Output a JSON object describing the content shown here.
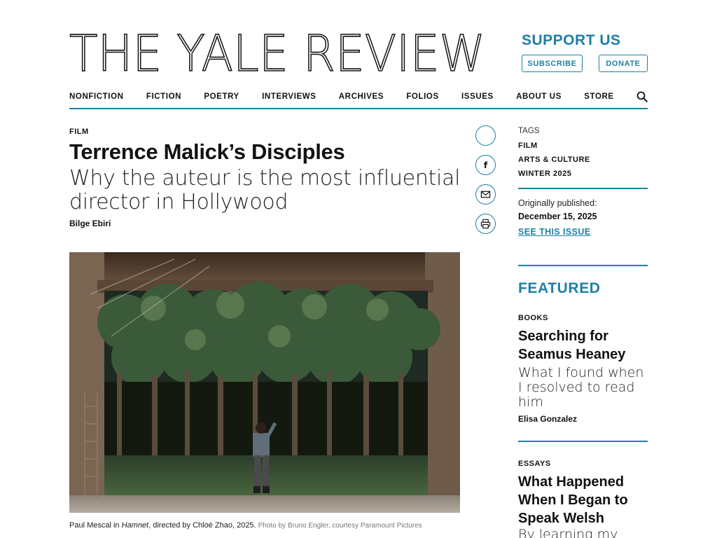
{
  "masthead": {
    "title": "THE YALE REVIEW"
  },
  "support": {
    "heading": "SUPPORT US",
    "subscribe_label": "SUBSCRIBE",
    "donate_label": "DONATE"
  },
  "nav": {
    "items": [
      "NONFICTION",
      "FICTION",
      "POETRY",
      "INTERVIEWS",
      "ARCHIVES",
      "FOLIOS",
      "ISSUES",
      "ABOUT US",
      "STORE"
    ],
    "search_icon": "search-icon"
  },
  "article": {
    "kicker": "FILM",
    "title": "Terrence Malick’s Disciples",
    "dek": "Why the auteur is the most influential director in Hollywood",
    "author": "Bilge Ebiri",
    "caption": {
      "name": "Paul Mescal in ",
      "film": "Hamnet",
      "rest": ", directed by Chloé Zhao, 2025.",
      "credit": "Photo by Bruno Engler, courtesy Paramount Pictures"
    }
  },
  "share_icons": [
    "share-icon",
    "facebook-icon",
    "email-icon",
    "print-icon"
  ],
  "sidebar": {
    "tags_label": "TAGS",
    "tags": [
      "FILM",
      "ARTS & CULTURE",
      "WINTER 2025"
    ],
    "published_label": "Originally published:",
    "published_date": "December 15, 2025",
    "see_issue": "SEE THIS ISSUE",
    "featured_heading": "FEATURED",
    "featured": [
      {
        "kicker": "BOOKS",
        "title": "Searching for Seamus Heaney",
        "dek": "What I found when I resolved to read him",
        "author": "Elisa Gonzalez"
      },
      {
        "kicker": "ESSAYS",
        "title": "What Happened When I Began to Speak Welsh",
        "dek": "By learning my"
      }
    ]
  },
  "colors": {
    "accent": "#1f7fa6",
    "text": "#111111"
  }
}
